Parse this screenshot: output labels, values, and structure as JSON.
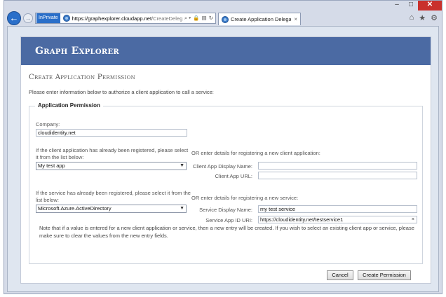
{
  "browser": {
    "inprivate_label": "InPrivate",
    "url_host": "https://graphexplorer.cloudapp.net",
    "url_path": "/CreateDelegati",
    "address_icons": [
      "⌕ ▾",
      "🔒",
      "▤",
      "↻"
    ],
    "tab_title": "Create Application Delegati...",
    "tab_close": "×",
    "window_controls": {
      "minimize": "–",
      "maximize": "□",
      "close": "✕"
    },
    "toolbar_icons": {
      "home": "⌂",
      "favorites": "★",
      "tools": "⚙"
    },
    "back_glyph": "←",
    "forward_glyph": "→"
  },
  "header": {
    "app_title": "Graph Explorer"
  },
  "page": {
    "title": "Create Application Permission",
    "intro": "Please enter information below to authorize a client application to call a service:"
  },
  "form": {
    "legend": "Application Permission",
    "company_label": "Company:",
    "company_value": "cloudidentity.net",
    "client_select_label": "If the client application has already been registered, please select it from the list below:",
    "client_select_value": "My test app",
    "client_new_label": "OR enter details for registering a new client application:",
    "client_display_name_label": "Client App Display Name:",
    "client_display_name_value": "",
    "client_url_label": "Client App URL:",
    "client_url_value": "",
    "service_select_label": "If the service has already been registered, please select it from the list below:",
    "service_select_value": "Microsoft.Azure.ActiveDirectory",
    "service_new_label": "OR enter details for registering a new service:",
    "service_display_name_label": "Service Display Name:",
    "service_display_name_value": "my test service",
    "service_app_id_label": "Service App ID URI:",
    "service_app_id_value": "https://cloudidentity.net/testservice1",
    "clear_glyph": "×",
    "note": "Note that if a value is entered for a new client application or service, then a new entry will be created. If you wish to select an existing client app or service, please make sure to clear the values from the new entry fields."
  },
  "actions": {
    "cancel_label": "Cancel",
    "create_label": "Create Permission"
  },
  "colors": {
    "banner": "#4b6aa3",
    "accent_blue": "#2a6fc9",
    "close_red": "#c9302c"
  }
}
